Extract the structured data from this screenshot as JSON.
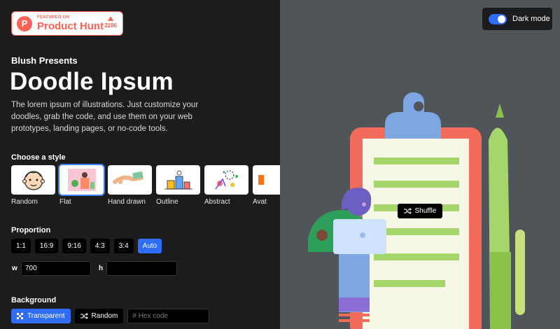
{
  "product_hunt": {
    "featured_text": "FEATURED ON",
    "name": "Product Hunt",
    "votes": "2286"
  },
  "header": {
    "presents": "Blush Presents",
    "title": "Doodle Ipsum",
    "description": "The lorem ipsum of illustrations. Just customize your doodles, grab the code, and use them on your web prototypes, landing pages, or no-code tools."
  },
  "style_section": {
    "label": "Choose a style",
    "items": [
      {
        "label": "Random",
        "selected": false
      },
      {
        "label": "Flat",
        "selected": true
      },
      {
        "label": "Hand drawn",
        "selected": false
      },
      {
        "label": "Outline",
        "selected": false
      },
      {
        "label": "Abstract",
        "selected": false
      },
      {
        "label": "Avat",
        "selected": false
      }
    ]
  },
  "proportion": {
    "label": "Proportion",
    "options": [
      "1:1",
      "16:9",
      "9:16",
      "4:3",
      "3:4",
      "Auto"
    ],
    "active": "Auto",
    "width_label": "w",
    "width_value": "700",
    "height_label": "h",
    "height_value": ""
  },
  "background": {
    "label": "Background",
    "transparent_label": "Transparent",
    "random_label": "Random",
    "hex_placeholder": "# Hex code"
  },
  "toolbar": {
    "dark_mode_label": "Dark mode",
    "dark_mode_on": true,
    "shuffle_label": "Shuffle"
  },
  "colors": {
    "accent": "#2f6df6",
    "product_hunt": "#ff6154",
    "preview_bg": "#4f5559",
    "panel_bg": "#1c1c1e"
  }
}
